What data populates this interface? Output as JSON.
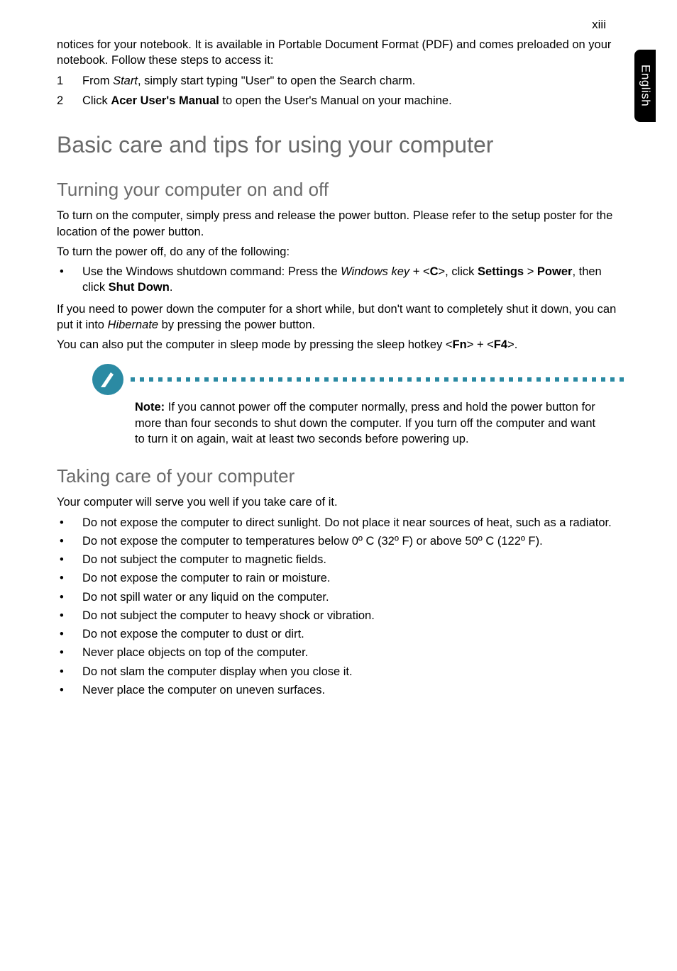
{
  "page_number": "xiii",
  "side_tab": "English",
  "intro": {
    "p1a": "notices for your notebook. It is available in Portable Document Format (PDF) and comes preloaded on your notebook. Follow these steps to access it:",
    "step1_pre": "From ",
    "step1_i": "Start",
    "step1_post": ", simply start typing \"User\" to open the Search charm.",
    "step2_pre": "Click ",
    "step2_b": "Acer User's Manual",
    "step2_post": " to open the User's Manual on your machine."
  },
  "h1": "Basic care and tips for using your computer",
  "turning": {
    "heading": "Turning your computer on and off",
    "p1": "To turn on the computer, simply press and release the power button. Please refer to the setup poster for the location of the power button.",
    "p2": "To turn the power off, do any of the following:",
    "bullet_pre": "Use the Windows shutdown command: Press the ",
    "bullet_i1": "Windows key",
    "bullet_mid1": " + <",
    "bullet_b1": "C",
    "bullet_mid2": ">, click ",
    "bullet_b2": "Settings",
    "bullet_gt": " > ",
    "bullet_b3": "Power",
    "bullet_mid3": ", then click ",
    "bullet_b4": "Shut Down",
    "bullet_end": ".",
    "p3_pre": "If you need to power down the computer for a short while, but don't want to completely shut it down, you can put it into ",
    "p3_i": "Hibernate",
    "p3_post": " by pressing the power button.",
    "p4_pre": "You can also put the computer in sleep mode by pressing the sleep hotkey <",
    "p4_b1": "Fn",
    "p4_mid": "> + <",
    "p4_b2": "F4",
    "p4_post": ">."
  },
  "note": {
    "label": "Note:",
    "text": " If you cannot power off the computer normally, press and hold the power button for more than four seconds to shut down the computer. If you turn off the computer and want to turn it on again, wait at least two seconds before powering up."
  },
  "taking_care": {
    "heading": "Taking care of your computer",
    "p1": "Your computer will serve you well if you take care of it.",
    "bullets": [
      "Do not expose the computer to direct sunlight. Do not place it near sources of heat, such as a radiator.",
      "Do not expose the computer to temperatures below 0º C (32º F) or above 50º C (122º F).",
      "Do not subject the computer to magnetic fields.",
      "Do not expose the computer to rain or moisture.",
      "Do not spill water or any liquid on the computer.",
      "Do not subject the computer to heavy shock or vibration.",
      "Do not expose the computer to dust or dirt.",
      "Never place objects on top of the computer.",
      "Do not slam the computer display when you close it.",
      "Never place the computer on uneven surfaces."
    ]
  }
}
